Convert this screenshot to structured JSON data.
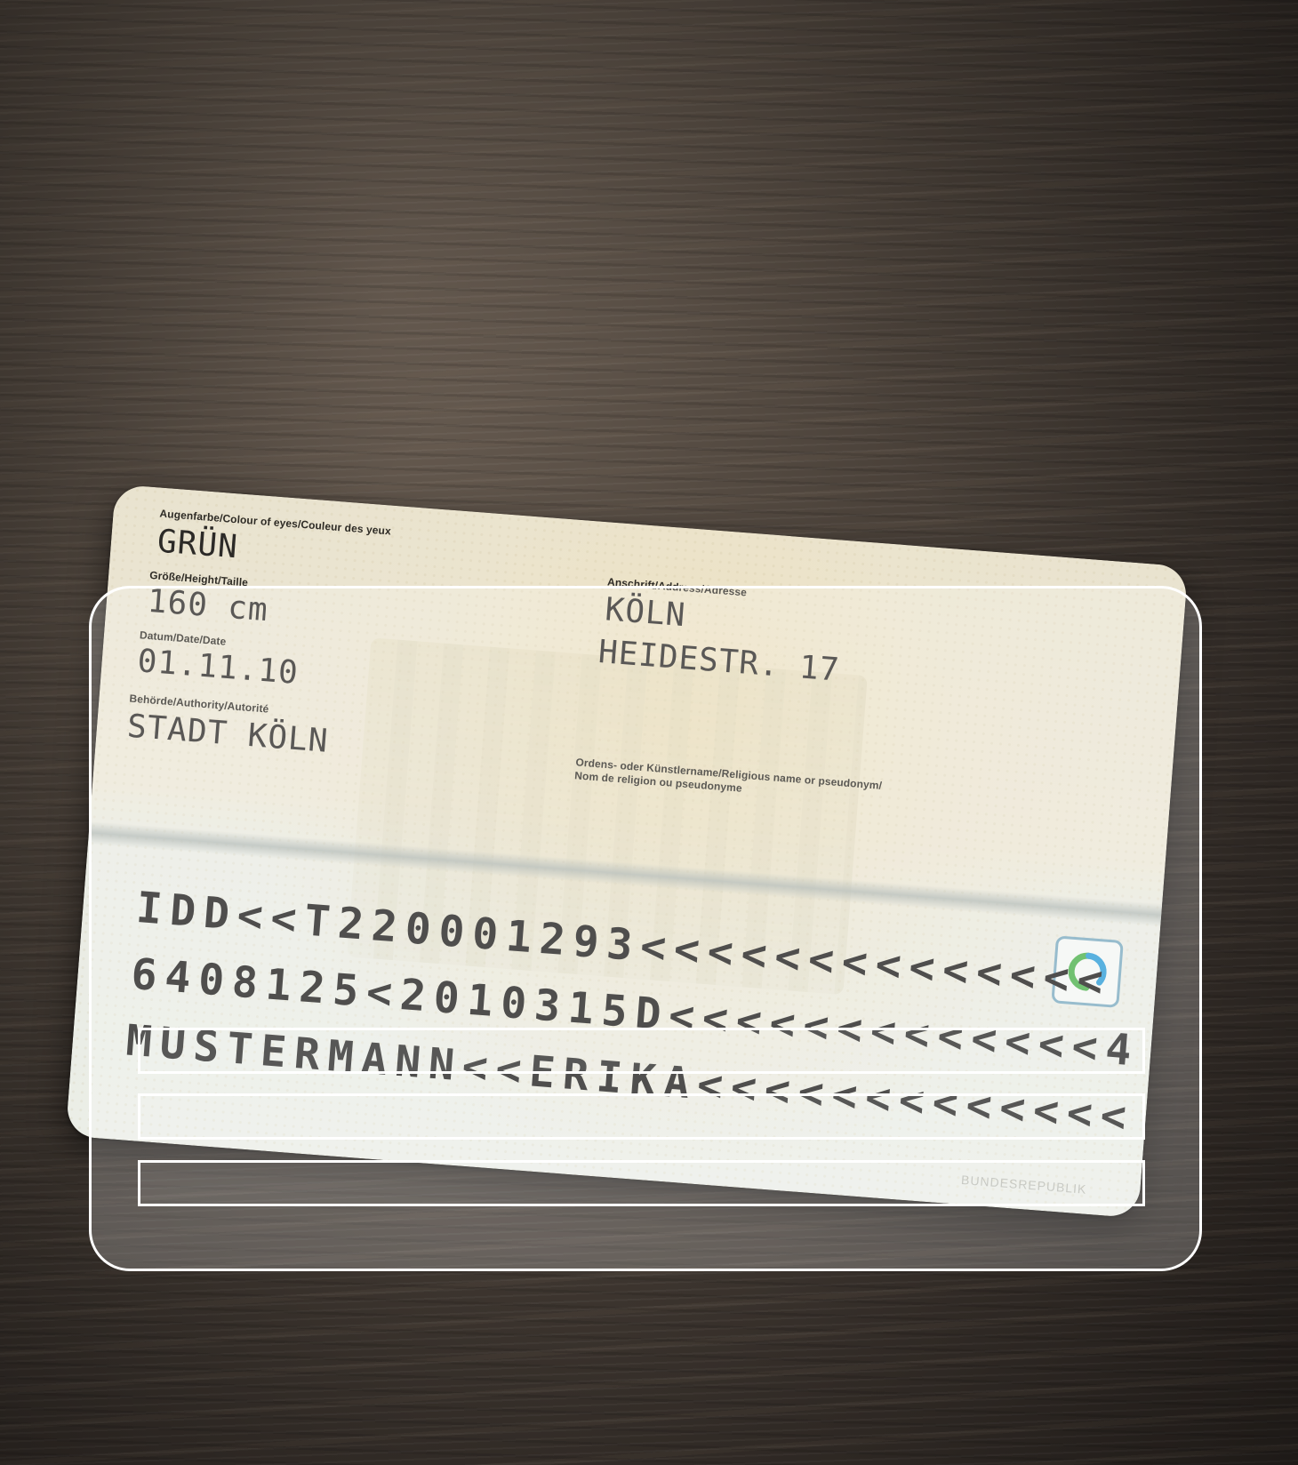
{
  "card": {
    "eye_color_label": "Augenfarbe/Colour of eyes/Couleur des yeux",
    "eye_color_value": "GRÜN",
    "height_label": "Größe/Height/Taille",
    "height_value": "160 cm",
    "date_label": "Datum/Date/Date",
    "date_value": "01.11.10",
    "authority_label": "Behörde/Authority/Autorité",
    "authority_value": "STADT KÖLN",
    "address_label": "Anschrift/Address/Adresse",
    "address_city": "KÖLN",
    "address_street": "HEIDESTR. 17",
    "religious_name_label_1": "Ordens- oder Künstlername/Religious name or pseudonym/",
    "religious_name_label_2": "Nom de religion ou pseudonyme",
    "mrz_line_1": "IDD<<T220001293<<<<<<<<<<<<<<",
    "mrz_line_2": "6408125<2010315D<<<<<<<<<<<<<4",
    "mrz_line_3": "MUSTERMANN<<ERIKA<<<<<<<<<<<<<",
    "footer_text": "BUNDESREPUBLIK",
    "can_icon": "eid-logo-icon"
  },
  "overlay": {
    "frame": "scan-frame",
    "guides": [
      "mrz-guide-line-1",
      "mrz-guide-line-2",
      "mrz-guide-line-3"
    ]
  },
  "colors": {
    "overlay_stroke": "#ffffff",
    "wood_dark": "#352e29",
    "wood_light": "#6a5e53",
    "icon_green": "#49b04a",
    "icon_blue": "#2b9bd6"
  }
}
